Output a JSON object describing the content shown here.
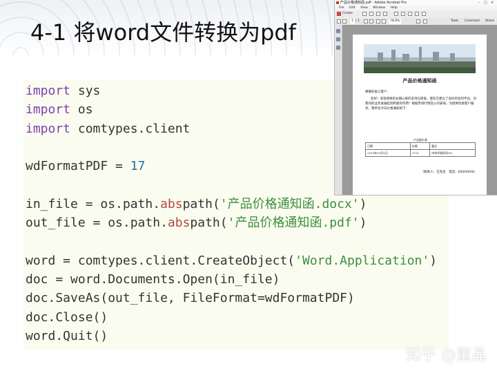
{
  "slide": {
    "title": "4-1 将word文件转换为pdf"
  },
  "code": {
    "lines": [
      [
        {
          "t": "import",
          "c": "kw"
        },
        {
          "t": " sys",
          "c": ""
        }
      ],
      [
        {
          "t": "import",
          "c": "kw"
        },
        {
          "t": " os",
          "c": ""
        }
      ],
      [
        {
          "t": "import",
          "c": "kw"
        },
        {
          "t": " comtypes.client",
          "c": ""
        }
      ],
      [],
      [
        {
          "t": "wdFormatPDF = ",
          "c": ""
        },
        {
          "t": "17",
          "c": "num"
        }
      ],
      [],
      [
        {
          "t": "in_file = os.path.",
          "c": ""
        },
        {
          "t": "abs",
          "c": "fn"
        },
        {
          "t": "path(",
          "c": ""
        },
        {
          "t": "'产品价格通知函.docx'",
          "c": "str"
        },
        {
          "t": ")",
          "c": ""
        }
      ],
      [
        {
          "t": "out_file = os.path.",
          "c": ""
        },
        {
          "t": "abs",
          "c": "fn"
        },
        {
          "t": "path(",
          "c": ""
        },
        {
          "t": "'产品价格通知函.pdf'",
          "c": "str"
        },
        {
          "t": ")",
          "c": ""
        }
      ],
      [],
      [
        {
          "t": "word = comtypes.client.CreateObject(",
          "c": ""
        },
        {
          "t": "'Word.Application'",
          "c": "str"
        },
        {
          "t": ")",
          "c": ""
        }
      ],
      [
        {
          "t": "doc = word.Documents.Open(in_file)",
          "c": ""
        }
      ],
      [
        {
          "t": "doc.SaveAs(out_file, FileFormat=wdFormatPDF)",
          "c": ""
        }
      ],
      [
        {
          "t": "doc.Close()",
          "c": ""
        }
      ],
      [
        {
          "t": "word.Quit()",
          "c": ""
        }
      ]
    ]
  },
  "acrobat": {
    "window_title": "产品价格通知函.pdf - Adobe Acrobat Pro",
    "menu": [
      "File",
      "Edit",
      "View",
      "Window",
      "Help"
    ],
    "create_label": "Create",
    "page_current": "1",
    "page_total": "/ 1",
    "zoom": "78.8%",
    "panels": [
      "Tools",
      "Comment",
      "Share"
    ]
  },
  "pdf": {
    "heading": "产品价格通知函",
    "greeting": "尊敬的张三客户:",
    "body": "您好！非常感谢您长期以来的支持与厚爱。使双方建立了良好的合作平台。对我司的业务发展起到积极的作用！根据市场行情及公司安排，为提供优质客户服务，我单位今日价格通知如下：",
    "table_caption": "产品报价表",
    "table_headers": [
      "日期",
      "价格",
      "备注"
    ],
    "table_row": [
      "2019年10月5日",
      "3721",
      "市场代理折扣5%"
    ],
    "contact": "（联系人：王先生　电话：66666666）"
  },
  "watermark": "知乎 @董晶"
}
